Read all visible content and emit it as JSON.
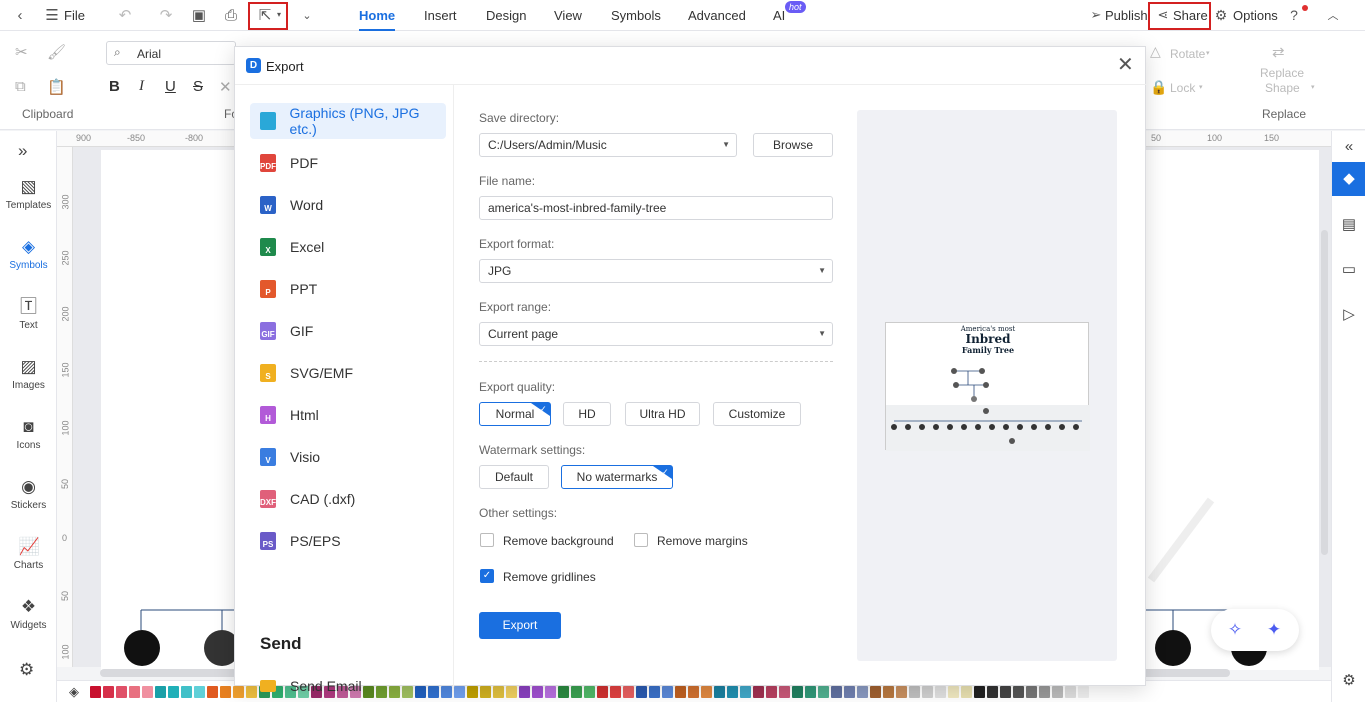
{
  "topbar": {
    "file_label": "File",
    "tabs": [
      "Home",
      "Insert",
      "Design",
      "View",
      "Symbols",
      "Advanced",
      "AI"
    ],
    "hot_badge": "hot",
    "publish_label": "Publish",
    "share_label": "Share",
    "options_label": "Options"
  },
  "ribbon": {
    "font_name": "Arial",
    "clipboard_label": "Clipboard",
    "font_label_partial": "Fo",
    "rotate_label": "Rotate",
    "lock_label": "Lock",
    "replace_shape_label_1": "Replace",
    "replace_shape_label_2": "Shape",
    "replace_label": "Replace"
  },
  "leftbar": {
    "items": [
      {
        "label": "Templates",
        "icon": "templates-icon"
      },
      {
        "label": "Symbols",
        "icon": "symbols-icon"
      },
      {
        "label": "Text",
        "icon": "text-icon"
      },
      {
        "label": "Images",
        "icon": "images-icon"
      },
      {
        "label": "Icons",
        "icon": "icons-icon"
      },
      {
        "label": "Stickers",
        "icon": "stickers-icon"
      },
      {
        "label": "Charts",
        "icon": "charts-icon"
      },
      {
        "label": "Widgets",
        "icon": "widgets-icon"
      }
    ]
  },
  "ruler": {
    "top": [
      "900",
      "-850",
      "-800",
      "-750",
      "-700",
      "50",
      "100",
      "150"
    ],
    "left": [
      "300",
      "250",
      "200",
      "150",
      "100",
      "50",
      "0",
      "50",
      "100"
    ]
  },
  "dialog": {
    "title": "Export",
    "formats": [
      {
        "label": "Graphics (PNG, JPG etc.)",
        "color": "#2aa8d8",
        "abbr": ""
      },
      {
        "label": "PDF",
        "color": "#e0463c",
        "abbr": "PDF"
      },
      {
        "label": "Word",
        "color": "#2b62c7",
        "abbr": "W"
      },
      {
        "label": "Excel",
        "color": "#1f8a4c",
        "abbr": "X"
      },
      {
        "label": "PPT",
        "color": "#e3582c",
        "abbr": "P"
      },
      {
        "label": "GIF",
        "color": "#8b6fe0",
        "abbr": "GIF"
      },
      {
        "label": "SVG/EMF",
        "color": "#f0b020",
        "abbr": "S"
      },
      {
        "label": "Html",
        "color": "#b25ad8",
        "abbr": "H"
      },
      {
        "label": "Visio",
        "color": "#3a7de0",
        "abbr": "V"
      },
      {
        "label": "CAD (.dxf)",
        "color": "#e0607a",
        "abbr": "DXF"
      },
      {
        "label": "PS/EPS",
        "color": "#6a5ac8",
        "abbr": "PS"
      }
    ],
    "send_heading": "Send",
    "send_email_label": "Send Email",
    "save_directory_label": "Save directory:",
    "save_directory_value": "C:/Users/Admin/Music",
    "browse_label": "Browse",
    "file_name_label": "File name:",
    "file_name_value": "america's-most-inbred-family-tree",
    "export_format_label": "Export format:",
    "export_format_value": "JPG",
    "export_range_label": "Export range:",
    "export_range_value": "Current page",
    "export_quality_label": "Export quality:",
    "quality_options": [
      "Normal",
      "HD",
      "Ultra HD",
      "Customize"
    ],
    "watermark_label": "Watermark settings:",
    "watermark_options": [
      "Default",
      "No watermarks"
    ],
    "other_settings_label": "Other settings:",
    "remove_background_label": "Remove background",
    "remove_margins_label": "Remove margins",
    "remove_gridlines_label": "Remove gridlines",
    "remove_background_checked": false,
    "remove_margins_checked": false,
    "remove_gridlines_checked": true,
    "export_button_label": "Export",
    "preview_title_1": "America's most",
    "preview_title_2": "Inbred",
    "preview_title_3": "Family Tree"
  },
  "palette": [
    "#c8102e",
    "#d6304a",
    "#e05068",
    "#e87080",
    "#f090a0",
    "#1aa0a8",
    "#20b0b8",
    "#40c0c8",
    "#60d0d8",
    "#e05a20",
    "#e88020",
    "#f0a030",
    "#f0c040",
    "#2a9a5a",
    "#30b070",
    "#50c090",
    "#70d0a8",
    "#9a2a6a",
    "#b03a80",
    "#c05a98",
    "#d07ab0",
    "#5a8a20",
    "#70a030",
    "#8ab040",
    "#a0c060",
    "#2060c0",
    "#3070d0",
    "#5088e0",
    "#70a0f0",
    "#c0a000",
    "#d0b020",
    "#e0c040",
    "#f0d060",
    "#8a40c0",
    "#a050d0",
    "#b870e0",
    "#2a8a40",
    "#3aa050",
    "#50b868",
    "#d03030",
    "#e04040",
    "#e86060",
    "#2a5ab0",
    "#3a70c8",
    "#5a88d8",
    "#c06020",
    "#d07030",
    "#e08840",
    "#1a80a0",
    "#2090b0",
    "#40a8c8",
    "#a03050",
    "#b84060",
    "#c85878",
    "#208060",
    "#309878",
    "#50b090",
    "#6070a0",
    "#7080b0",
    "#8898c0",
    "#a06030",
    "#b87840",
    "#c89060",
    "#c0c0c0",
    "#d0d0d0",
    "#e0e0e0",
    "#f0e8c0",
    "#e8e0b0",
    "#222222",
    "#333333",
    "#444444",
    "#555555",
    "#777777",
    "#999999",
    "#bbbbbb",
    "#dddddd",
    "#eeeeee"
  ]
}
